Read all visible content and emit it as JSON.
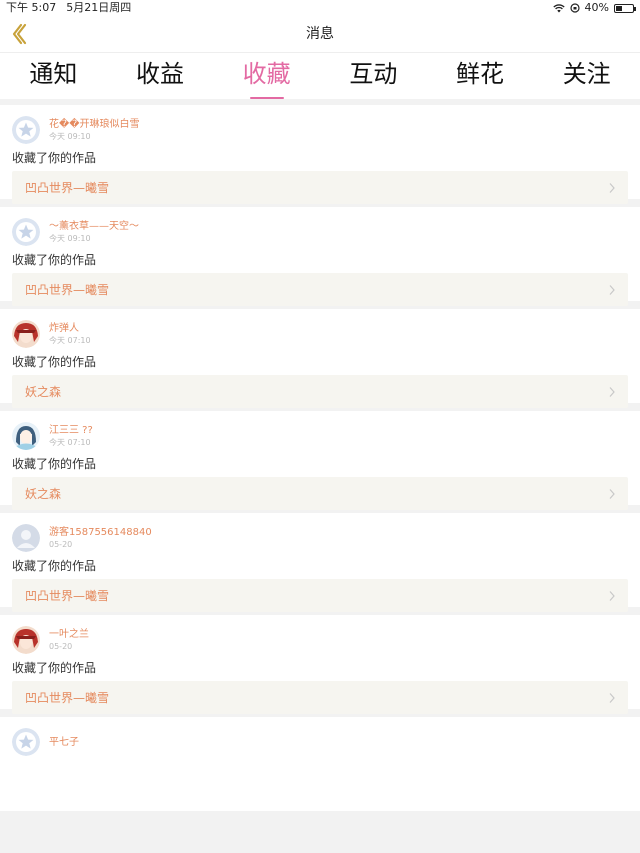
{
  "status_bar": {
    "time": "下午 5:07",
    "date": "5月21日周四",
    "battery": "40%",
    "battery_level": 0.4
  },
  "nav": {
    "title": "消息"
  },
  "tabs": [
    {
      "label": "通知"
    },
    {
      "label": "收益"
    },
    {
      "label": "收藏"
    },
    {
      "label": "互动"
    },
    {
      "label": "鲜花"
    },
    {
      "label": "关注"
    }
  ],
  "active_tab": 2,
  "colors": {
    "accent": "#e36aa3",
    "username": "#e58a5e",
    "work_bg": "#f6f5f0"
  },
  "items": [
    {
      "user": "花��开琳琅似白雪",
      "time": "今天 09:10",
      "action": "收藏了你的作品",
      "work": "凹凸世界—曦雪",
      "avatar": "default-star-avatar"
    },
    {
      "user": "～薰衣草——天空～",
      "time": "今天 09:10",
      "action": "收藏了你的作品",
      "work": "凹凸世界—曦雪",
      "avatar": "default-star-avatar"
    },
    {
      "user": "炸弹人",
      "time": "今天 07:10",
      "action": "收藏了你的作品",
      "work": "妖之森",
      "avatar": "anime-red-avatar"
    },
    {
      "user": "江三三 ??",
      "time": "今天 07:10",
      "action": "收藏了你的作品",
      "work": "妖之森",
      "avatar": "anime-blue-avatar"
    },
    {
      "user": "游客1587556148840",
      "time": "05-20",
      "action": "收藏了你的作品",
      "work": "凹凸世界—曦雪",
      "avatar": "default-person-avatar"
    },
    {
      "user": "一叶之兰",
      "time": "05-20",
      "action": "收藏了你的作品",
      "work": "凹凸世界—曦雪",
      "avatar": "anime-red-avatar"
    },
    {
      "user": "平七子",
      "time": "",
      "action": "",
      "work": "",
      "avatar": "default-star-avatar"
    }
  ]
}
